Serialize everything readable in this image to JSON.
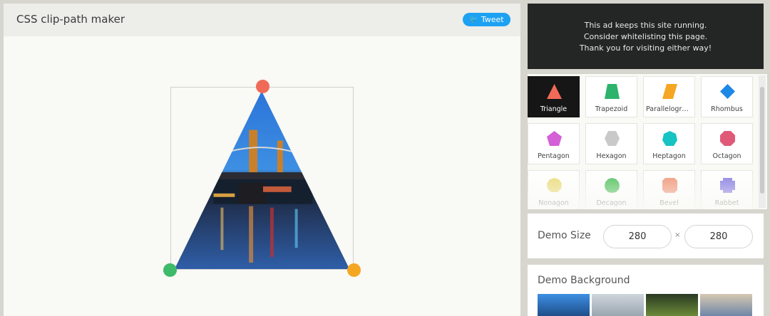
{
  "header": {
    "title": "CSS clip-path maker",
    "tweet_label": "Tweet"
  },
  "ad": {
    "lines": [
      "This ad keeps this site running.",
      "Consider whitelisting this page.",
      "Thank you for visiting either way!"
    ]
  },
  "shapes": [
    {
      "label": "Triangle",
      "color": "#f06a58",
      "icon": "triangle-icon",
      "active": true
    },
    {
      "label": "Trapezoid",
      "color": "#2db36b",
      "icon": "trapezoid-icon"
    },
    {
      "label": "Parallelogra...",
      "color": "#f5a623",
      "icon": "parallelogram-icon"
    },
    {
      "label": "Rhombus",
      "color": "#1e88e5",
      "icon": "rhombus-icon"
    },
    {
      "label": "Pentagon",
      "color": "#d45fd6",
      "icon": "pentagon-icon"
    },
    {
      "label": "Hexagon",
      "color": "#c9c9c9",
      "icon": "hexagon-icon"
    },
    {
      "label": "Heptagon",
      "color": "#17c3c3",
      "icon": "heptagon-icon"
    },
    {
      "label": "Octagon",
      "color": "#e05a78",
      "icon": "octagon-icon"
    },
    {
      "label": "Nonagon",
      "color": "#e8d86a",
      "icon": "nonagon-icon"
    },
    {
      "label": "Decagon",
      "color": "#3dba4a",
      "icon": "decagon-icon"
    },
    {
      "label": "Bevel",
      "color": "#f08a6a",
      "icon": "bevel-icon"
    },
    {
      "label": "Rabbet",
      "color": "#7b6fe0",
      "icon": "rabbet-icon"
    }
  ],
  "demo_size": {
    "label": "Demo Size",
    "width": "280",
    "height": "280",
    "separator": "×"
  },
  "demo_background": {
    "label": "Demo Background"
  }
}
